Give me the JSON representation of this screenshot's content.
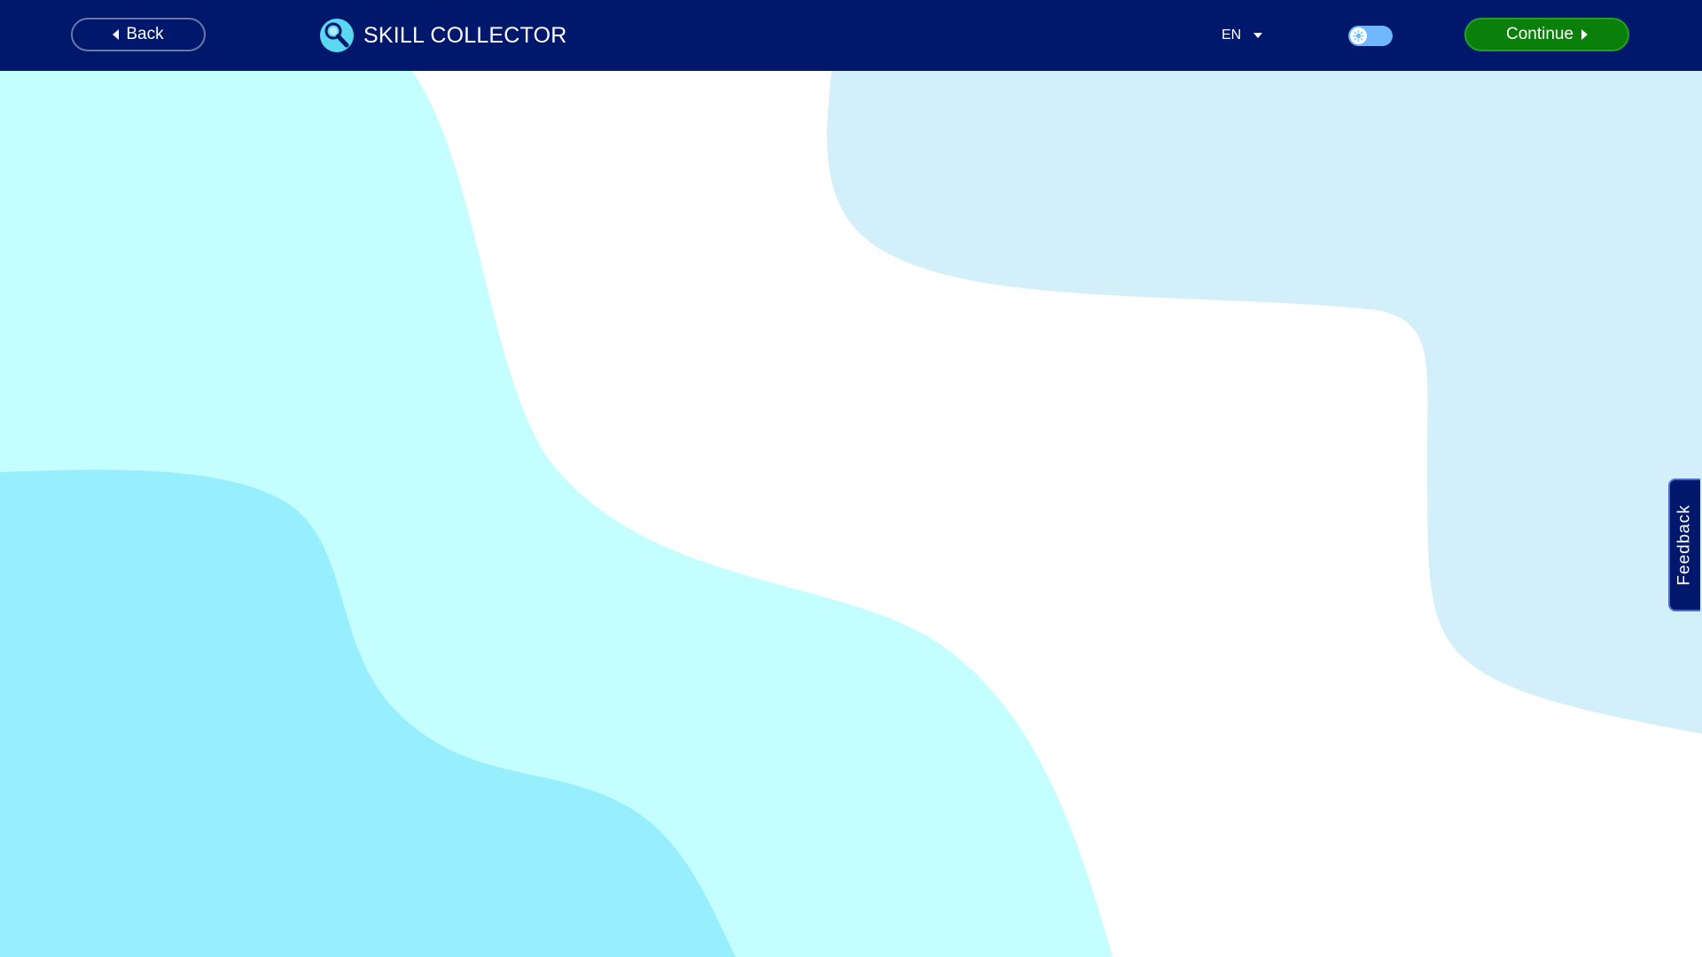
{
  "header": {
    "back_label": "Back",
    "app_title": "SKILL COLLECTOR",
    "language": "EN",
    "continue_label": "Continue"
  },
  "theme_toggle": {
    "state": "light"
  },
  "feedback": {
    "label": "Feedback"
  },
  "icons": {
    "back": "caret-left-icon",
    "logo": "magnifier-logo-icon",
    "language_dropdown": "chevron-down-icon",
    "theme": "sun-icon",
    "continue": "caret-right-icon"
  },
  "colors": {
    "header_bg": "#00186b",
    "continue_button": "#0a7f0a",
    "toggle_track": "#6fb7ff",
    "wave_light_cyan": "#c4feff",
    "wave_cyan": "#97eefc",
    "wave_pale_blue": "#d3eff9",
    "page_bg": "#ffffff"
  }
}
